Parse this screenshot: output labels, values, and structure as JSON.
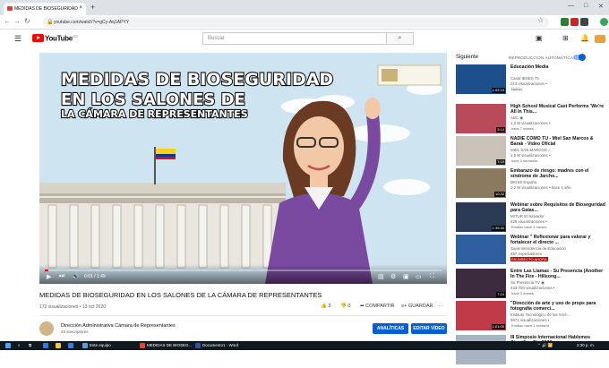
{
  "browser": {
    "tab_title": "MEDIDAS DE BIOSEGURIDAD",
    "tab_close": "×",
    "new_tab": "+",
    "url": "youtube.com/watch?v=gCy-Aq1APYY"
  },
  "youtube": {
    "logo_text": "YouTube",
    "country": "CO",
    "search_placeholder": "Buscar"
  },
  "player": {
    "slide_title_lines": [
      "MEDIDAS DE BIOSEGURIDAD",
      "EN LOS SALONES DE",
      "LA CÁMARA DE REPRESENTANTES"
    ],
    "timecode": "0:01 / 1:49",
    "progress": 0.01
  },
  "video": {
    "title": "MEDIDAS DE BIOSEGURIDAD EN LOS SALONES DE LA CÁMARA DE REPRESENTANTES",
    "meta": "172 visualizaciones • 13 oct 2020",
    "likes": "3",
    "dislikes": "0",
    "share_label": "COMPARTIR",
    "save_label": "GUARDAR",
    "more_label": "···"
  },
  "channel": {
    "name": "Dirección Administrativa Cámara de Representantes",
    "subs": "23 suscriptores",
    "analytics_label": "ANALÍTICAS",
    "edit_label": "EDITAR VÍDEO"
  },
  "sidebar": {
    "heading": "Siguiente",
    "autoplay_label": "REPRODUCCIÓN AUTOMÁTICA",
    "items": [
      {
        "title": "Educación Media",
        "channel": "Canal IBSES TV",
        "views": "213 visualizaciones •",
        "extra": "Emitido hace 5 días",
        "badge": "Nuevo",
        "duration": "1:02:15",
        "color": "#1d4f8c"
      },
      {
        "title": "High School Musical Cast Performs 'We're All In This...",
        "channel": "ABC ◉",
        "views": "1,2 M visualizaciones •",
        "extra": "hace 7 meses",
        "badge": "",
        "duration": "3:14",
        "color": "#b84a5a"
      },
      {
        "title": "NADIE COMO TU - Miel San Marcos & Barak - Video Oficial",
        "channel": "MIEL SAN MARCOS ♪",
        "views": "1,5 M visualizaciones •",
        "extra": "hace 3 semanas",
        "badge": "",
        "duration": "7:19",
        "color": "#c9c2b8"
      },
      {
        "title": "Embarazo de riesgo: madres con el síndrome de Jarcho...",
        "channel": "DKISS España",
        "views": "3,2 M visualizaciones • hace 1 año",
        "extra": "",
        "badge": "",
        "duration": "10:32",
        "color": "#8c7a60"
      },
      {
        "title": "Webinar sobre Requisitos de Bioseguridad para Galas...",
        "channel": "MITUR El Salvador",
        "views": "625 visualizaciones •",
        "extra": "Emitido hace 4 meses",
        "badge": "",
        "duration": "1:35:40",
        "color": "#2b3a55"
      },
      {
        "title": "Webinar \" Reflexionar para valorar y fortalecer el directo ...",
        "channel": "Superintendencia de Educación",
        "views": "487 espectadores",
        "extra": "",
        "badge": "EN DIRECTO AHORA",
        "duration": "",
        "color": "#2f5e9e"
      },
      {
        "title": "Entre Las Llamas - Su Presencia (Another In The Fire - Hillsong...",
        "channel": "Su Presencia TV ◉",
        "views": "443.703 visualizaciones •",
        "extra": "hace 3 meses",
        "badge": "",
        "duration": "7:24",
        "color": "#3c2a3e"
      },
      {
        "title": "\"Dirección de arte y uso de props para fotografía comerci...",
        "channel": "Instituto Tecnológico de las Amé...",
        "views": "3671 visualizaciones •",
        "extra": "Emitido hace 1 semana",
        "badge": "",
        "duration": "1:01:05",
        "color": "#c03a48"
      },
      {
        "title": "III Simposio Internacional Hablemos Científico Rio 2020",
        "channel": "",
        "views": "",
        "extra": "",
        "badge": "",
        "duration": "",
        "color": "#a8b4c4"
      }
    ]
  },
  "taskbar": {
    "search_label": "Este equipo",
    "app1_label": "MEDIDAS DE BIOSEG...",
    "app2_label": "Documento1 - Word",
    "clock": "2:30 p. m."
  }
}
